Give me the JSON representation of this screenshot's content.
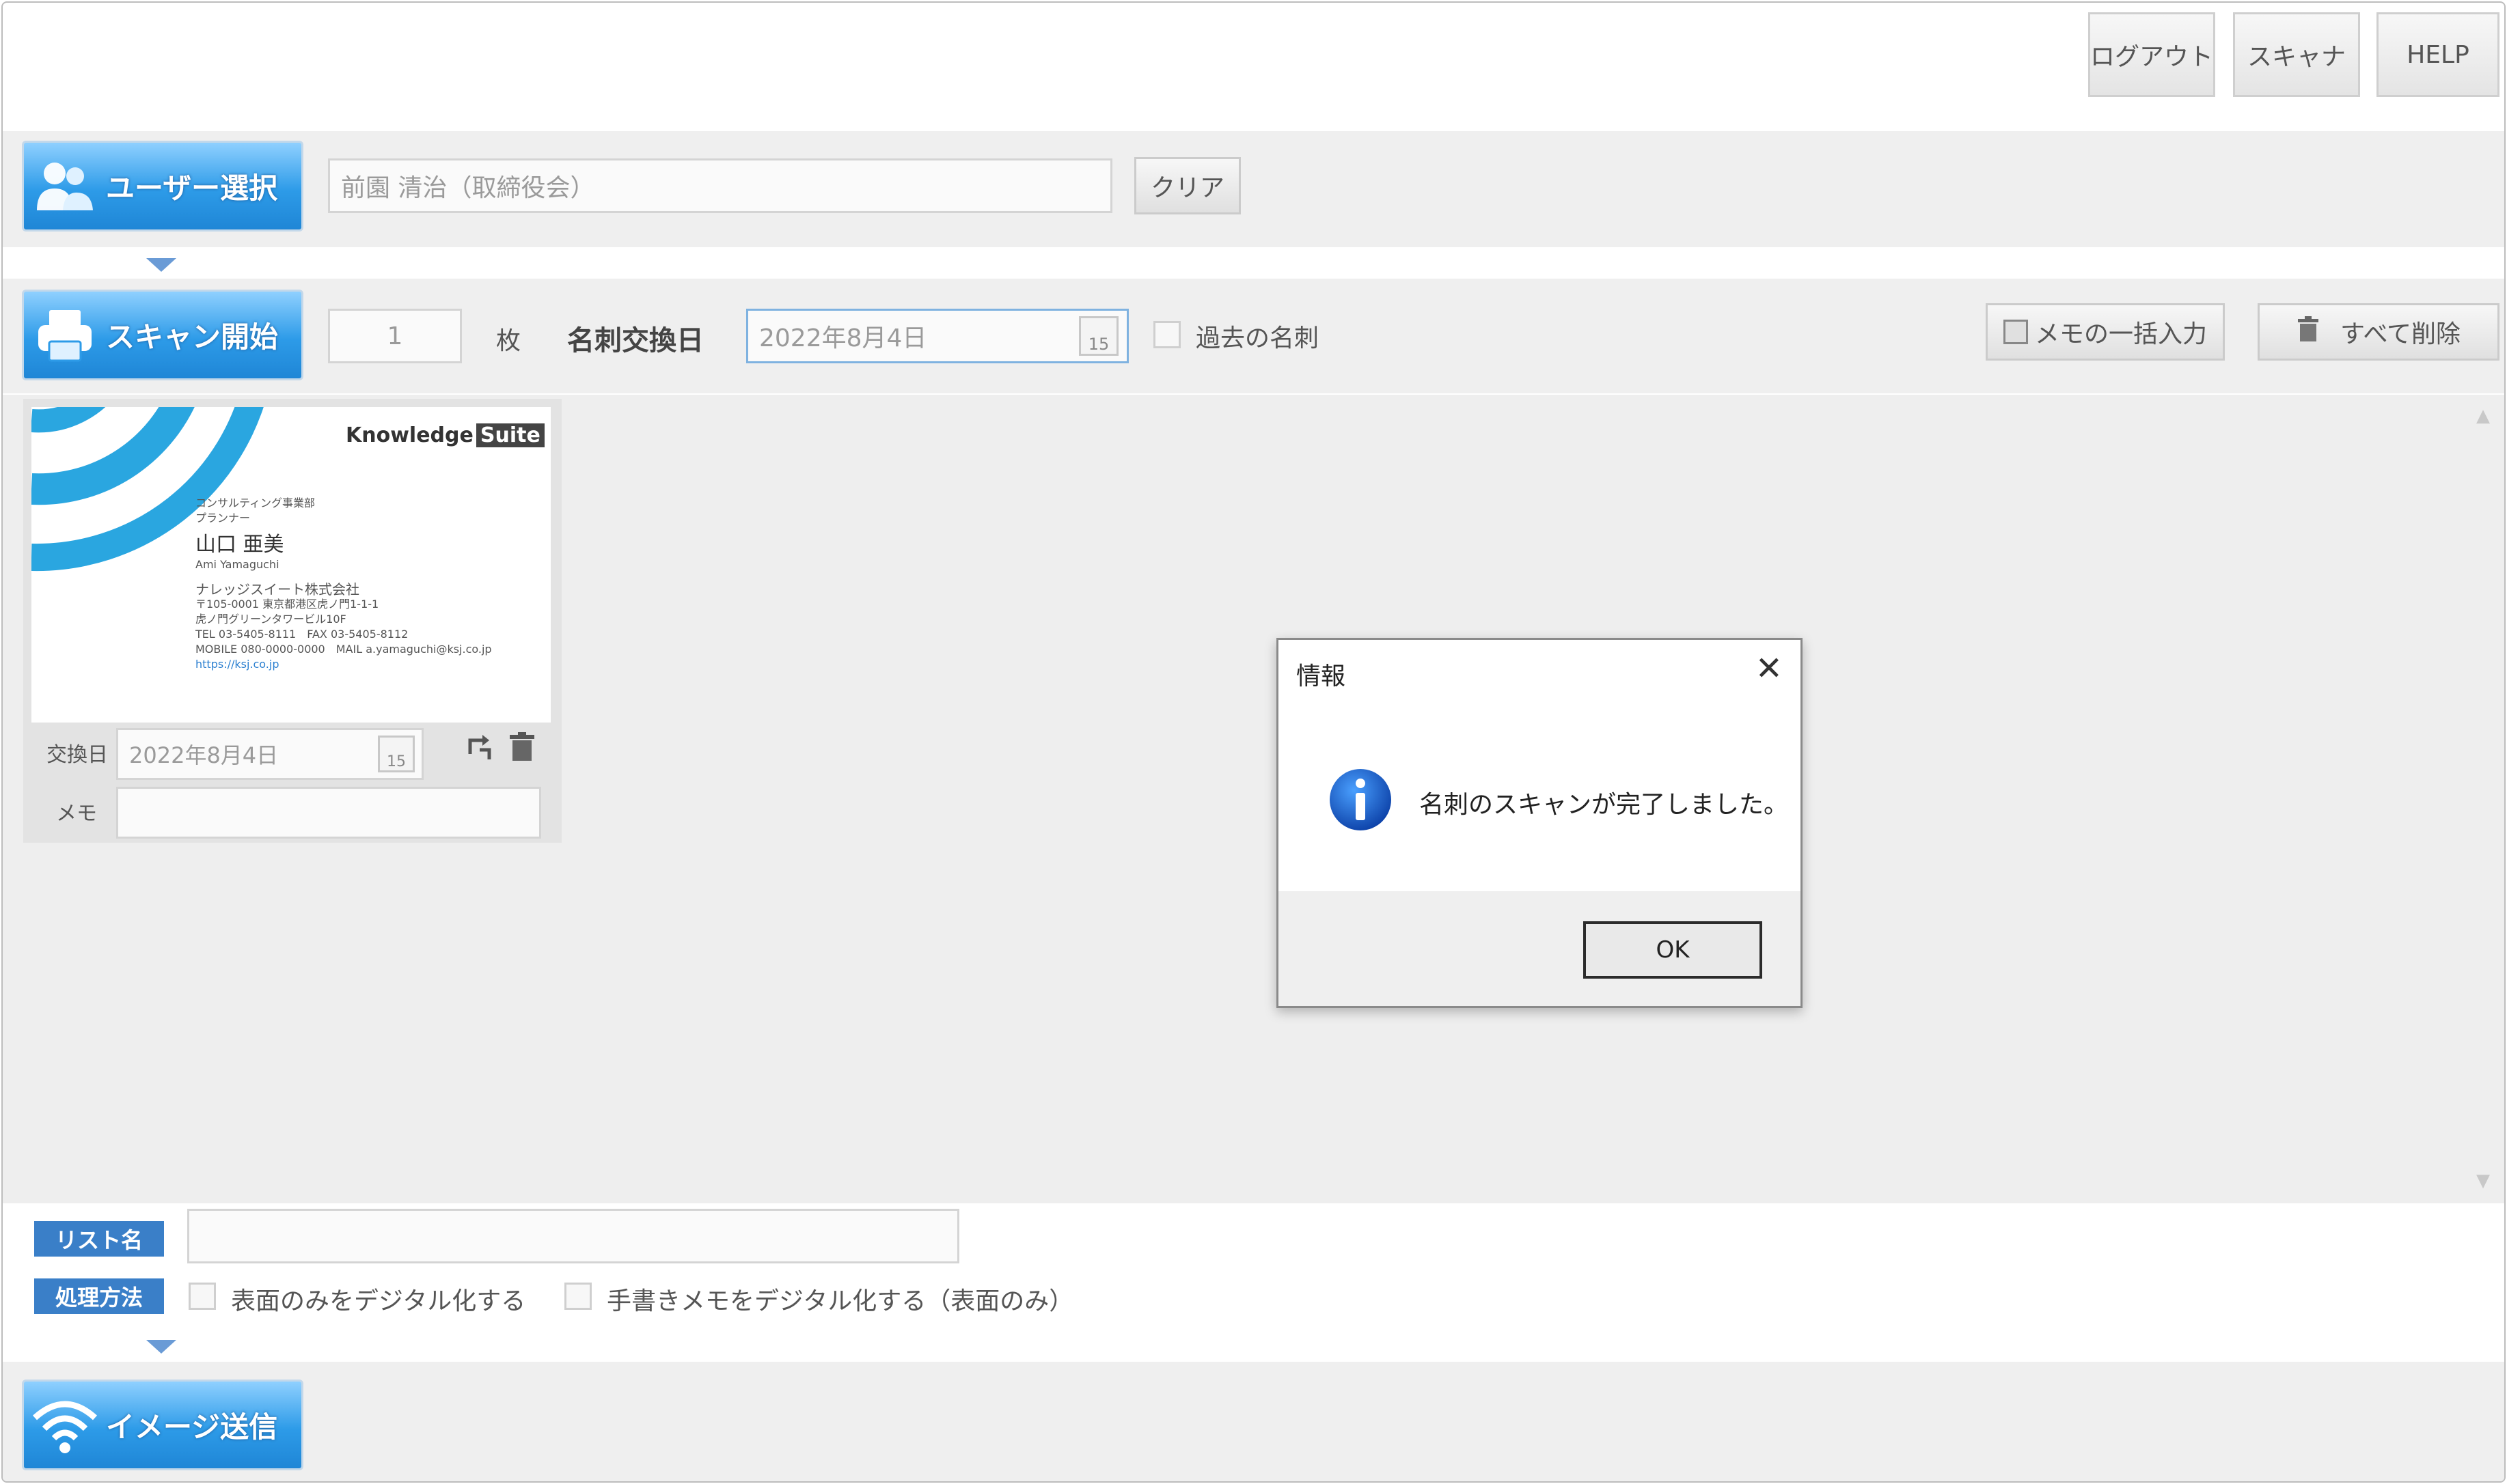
{
  "header": {
    "buttons": [
      "ログアウト",
      "スキャナ",
      "HELP"
    ]
  },
  "user_select": {
    "label": "ユーザー選択",
    "value": "前園 清治（取締役会）",
    "clear_label": "クリア"
  },
  "scan": {
    "label": "スキャン開始",
    "count": "1",
    "count_unit": "枚",
    "exchange_date_label": "名刺交換日",
    "exchange_date_value": "2022年8月4日",
    "calendar_day": "15",
    "past_cards_label": "過去の名刺",
    "memo_bulk_label": "メモの一括入力",
    "delete_all_label": "すべて削除"
  },
  "card": {
    "brand": "Knowledge",
    "brand_suffix": "Suite",
    "dept": "コンサルティング事業部",
    "role": "プランナー",
    "name_jp": "山口 亜美",
    "name_en": "Ami Yamaguchi",
    "company": "ナレッジスイート株式会社",
    "address1": "〒105-0001 東京都港区虎ノ門1-1-1",
    "address2": "虎ノ門グリーンタワービル10F",
    "tel": "TEL 03-5405-8111",
    "fax": "FAX 03-5405-8112",
    "mobile": "MOBILE 080-0000-0000",
    "mail": "MAIL a.yamaguchi@ksj.co.jp",
    "url": "https://ksj.co.jp",
    "exchange_label": "交換日",
    "exchange_value": "2022年8月4日",
    "memo_label": "メモ"
  },
  "bottom": {
    "list_name_label": "リスト名",
    "method_label": "処理方法",
    "option1": "表面のみをデジタル化する",
    "option2": "手書きメモをデジタル化する（表面のみ）",
    "send_label": "イメージ送信"
  },
  "dialog": {
    "title": "情報",
    "message": "名刺のスキャンが完了しました。",
    "ok_label": "OK"
  },
  "colors": {
    "accent": "#2d9be8",
    "tag": "#3a7fc8",
    "card_arc": "#2aa6e0"
  }
}
